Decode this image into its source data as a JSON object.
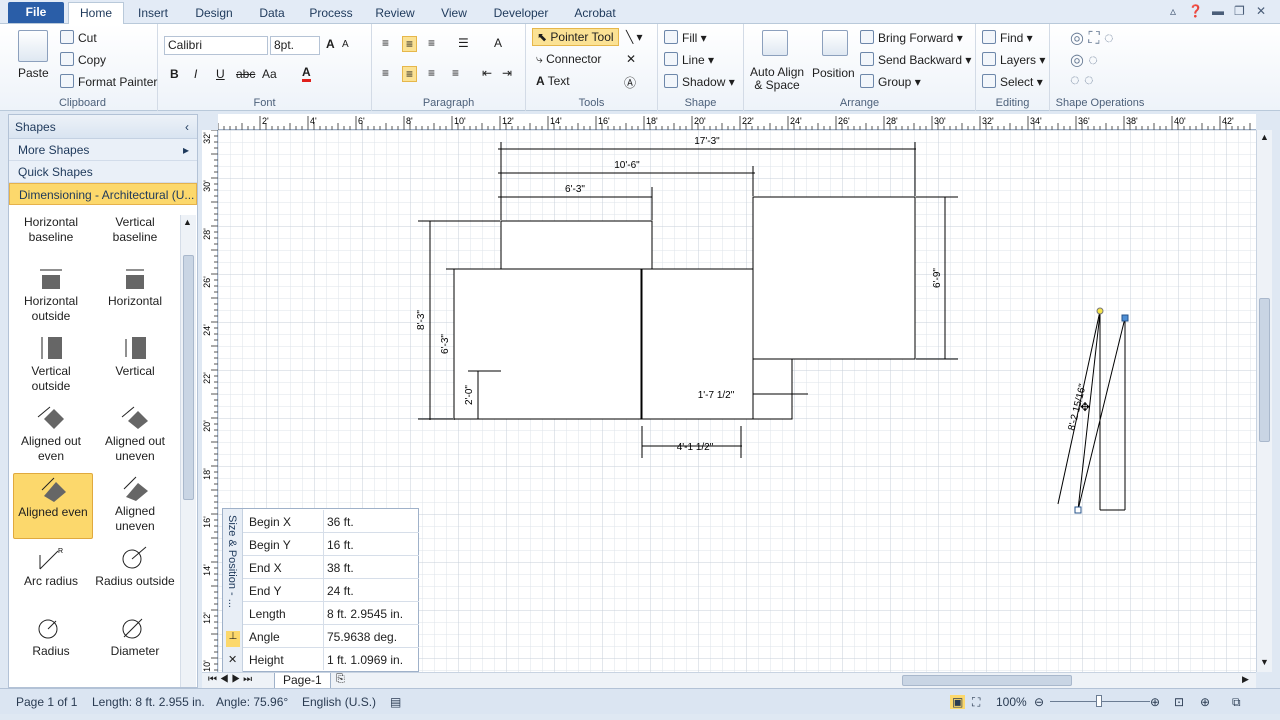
{
  "menu": {
    "file": "File",
    "tabs": [
      "Home",
      "Insert",
      "Design",
      "Data",
      "Process",
      "Review",
      "View",
      "Developer",
      "Acrobat"
    ],
    "active_tab": "Home"
  },
  "ribbon": {
    "clipboard": {
      "paste": "Paste",
      "cut": "Cut",
      "copy": "Copy",
      "format_painter": "Format Painter",
      "label": "Clipboard"
    },
    "font": {
      "name": "Calibri",
      "size": "8pt.",
      "label": "Font",
      "bold": "B",
      "italic": "I",
      "underline": "U",
      "strike": "abc",
      "case": "Aa",
      "color": "A",
      "grow": "A"
    },
    "paragraph": {
      "label": "Paragraph"
    },
    "tools": {
      "pointer": "Pointer Tool",
      "connector": "Connector",
      "text": "Text",
      "label": "Tools"
    },
    "shape": {
      "fill": "Fill",
      "line": "Line",
      "shadow": "Shadow",
      "label": "Shape"
    },
    "arrange": {
      "auto_align": "Auto Align",
      "auto_align2": "& Space",
      "position": "Position",
      "bring_forward": "Bring Forward",
      "send_backward": "Send Backward",
      "group": "Group",
      "label": "Arrange"
    },
    "editing": {
      "find": "Find",
      "layers": "Layers",
      "select": "Select",
      "label": "Editing"
    },
    "shape_ops": {
      "label": "Shape Operations"
    }
  },
  "shapes_panel": {
    "title": "Shapes",
    "more_shapes": "More Shapes",
    "quick_shapes": "Quick Shapes",
    "stencil": "Dimensioning - Architectural (U...",
    "items": [
      {
        "label": "Horizontal baseline"
      },
      {
        "label": "Vertical baseline"
      },
      {
        "label": "Horizontal outside"
      },
      {
        "label": "Horizontal"
      },
      {
        "label": "Vertical outside"
      },
      {
        "label": "Vertical"
      },
      {
        "label": "Aligned out even"
      },
      {
        "label": "Aligned out uneven"
      },
      {
        "label": "Aligned even"
      },
      {
        "label": "Aligned uneven"
      },
      {
        "label": "Arc radius"
      },
      {
        "label": "Radius outside"
      },
      {
        "label": "Radius"
      },
      {
        "label": "Diameter"
      }
    ],
    "selected": "Aligned even"
  },
  "ruler": {
    "h_ticks": [
      "2'",
      "4'",
      "6'",
      "8'",
      "10'",
      "12'",
      "14'",
      "16'",
      "18'",
      "20'",
      "22'",
      "24'",
      "26'",
      "28'",
      "30'",
      "32'",
      "34'",
      "36'",
      "38'",
      "40'",
      "42'"
    ],
    "v_ticks": [
      "32'",
      "30'",
      "28'",
      "26'",
      "24'",
      "22'",
      "20'",
      "18'",
      "16'",
      "14'",
      "12'",
      "10'"
    ]
  },
  "drawing": {
    "dims": {
      "d1": "17'-3\"",
      "d2": "10'-6\"",
      "d3": "6'-3\"",
      "d4": "6'-9\"",
      "d5": "8'-3\"",
      "d6": "6'-3\"",
      "d7": "2'-0\"",
      "d8": "1'-7 1/2\"",
      "d9": "4'-1 1/2\"",
      "d10": "8'-2 15/16\""
    }
  },
  "size_position": {
    "title": "Size & Position - ...",
    "rows": [
      {
        "k": "Begin X",
        "v": "36 ft."
      },
      {
        "k": "Begin Y",
        "v": "16 ft."
      },
      {
        "k": "End X",
        "v": "38 ft."
      },
      {
        "k": "End Y",
        "v": "24 ft."
      },
      {
        "k": "Length",
        "v": "8 ft. 2.9545 in."
      },
      {
        "k": "Angle",
        "v": "75.9638 deg."
      },
      {
        "k": "Height",
        "v": "1 ft. 1.0969 in."
      }
    ]
  },
  "page_tab": "Page-1",
  "status": {
    "page": "Page 1 of 1",
    "length": "Length: 8 ft. 2.955 in.",
    "angle": "Angle: 75.96°",
    "language": "English (U.S.)",
    "zoom": "100%"
  }
}
